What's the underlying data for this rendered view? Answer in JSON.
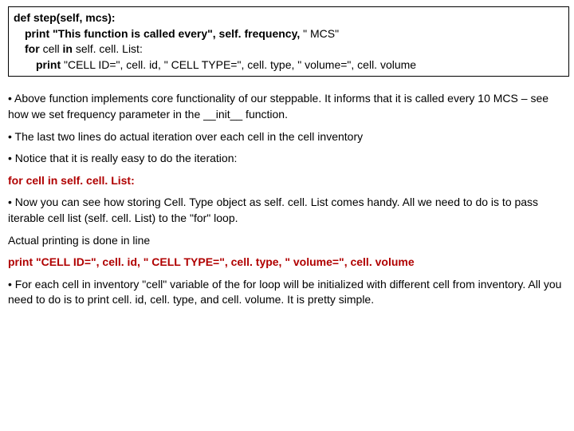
{
  "code": {
    "l1a": "def ",
    "l1b": "step(self, mcs):",
    "l2a": "print ",
    "l2b": "\"This function is called every\", self. frequency, ",
    "l2c": "\" MCS\"",
    "l3a": "for ",
    "l3b": "cell ",
    "l3c": "in ",
    "l3d": "self. cell. List:",
    "l4a": "print ",
    "l4b": "\"CELL ID=\", cell. id, \" CELL TYPE=\", cell. type, \" volume=\", cell. volume"
  },
  "p1": "• Above function implements core functionality of our steppable. It informs that it is called every 10 MCS – see how we set frequency parameter in  the __init__ function.",
  "p2": "• The last two lines do actual iteration over each cell in the cell inventory",
  "p3": "• Notice that it is really easy to do the iteration:",
  "forline": {
    "a": "for ",
    "b": "cell ",
    "c": "in ",
    "d": "self. cell. List:"
  },
  "p4": "• Now you can see how storing Cell. Type object as self. cell. List comes handy. All we need to do is to pass iterable cell list (self. cell. List) to the \"for\" loop.",
  "p5": "Actual printing is done in line",
  "printline": {
    "a": "print ",
    "b": "\"CELL ID=\", cell. id, \" CELL TYPE=\", cell. type, \" volume=\", cell. volume"
  },
  "p6": "• For each cell in inventory \"cell\" variable of the for loop will be initialized with different cell from inventory. All you need to do is to print cell. id, cell. type, and cell. volume. It is pretty simple."
}
